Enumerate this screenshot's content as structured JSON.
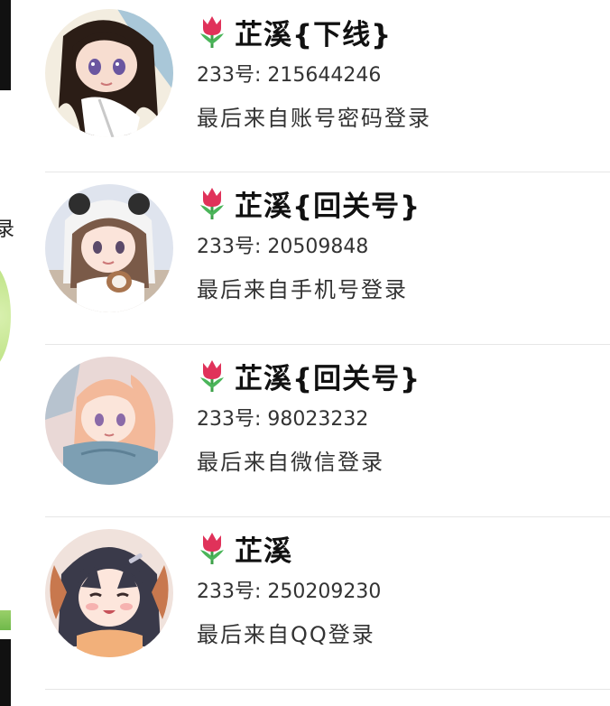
{
  "accounts": [
    {
      "name": "芷溪{下线}",
      "uid": "233号: 215644246",
      "login_source": "最后来自账号密码登录",
      "avatar_icon": "anime-avatar",
      "colors": {
        "bg1": "#f3ede0",
        "hair": "#2b1d16",
        "skin": "#f7ddd0",
        "accent": "#6a56a0"
      }
    },
    {
      "name": "芷溪{回关号}",
      "uid": "233号: 20509848",
      "login_source": "最后来自手机号登录",
      "avatar_icon": "anime-avatar",
      "colors": {
        "bg1": "#dfe4ee",
        "hair": "#7a5a48",
        "skin": "#fbe4da",
        "accent": "#2e2e2e"
      }
    },
    {
      "name": "芷溪{回关号}",
      "uid": "233号: 98023232",
      "login_source": "最后来自微信登录",
      "avatar_icon": "anime-avatar",
      "colors": {
        "bg1": "#e9d8d6",
        "hair": "#f3b99a",
        "skin": "#fbe5da",
        "accent": "#7d9fb3"
      }
    },
    {
      "name": "芷溪",
      "uid": "233号: 250209230",
      "login_source": "最后来自QQ登录",
      "avatar_icon": "anime-avatar",
      "colors": {
        "bg1": "#f0e2dc",
        "hair": "#3a3a4a",
        "skin": "#fde6dc",
        "accent": "#c8784e"
      }
    }
  ],
  "edge_glyph": "录"
}
